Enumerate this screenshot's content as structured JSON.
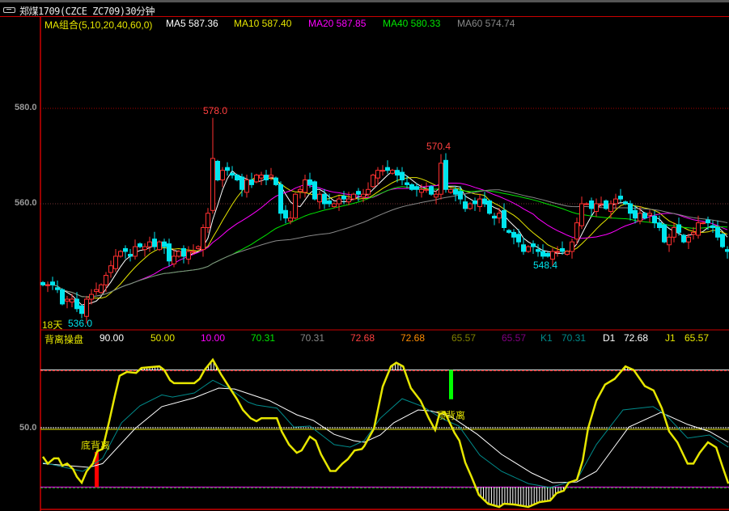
{
  "header": {
    "title": "郑煤1709(CZCE ZC709)30分钟"
  },
  "ma_legend": [
    {
      "label": "MA组合(5,10,20,40,60,0)",
      "color": "#e6e600"
    },
    {
      "label": "MA5 587.36",
      "color": "#ffffff"
    },
    {
      "label": "MA10 587.40",
      "color": "#e6e600"
    },
    {
      "label": "MA20 587.85",
      "color": "#ff00ff"
    },
    {
      "label": "MA40 580.33",
      "color": "#00e600"
    },
    {
      "label": "MA60 574.74",
      "color": "#888888"
    }
  ],
  "indicator_legend": [
    {
      "label": "背离操盘",
      "color": "#e6e600"
    },
    {
      "label": "90.00",
      "color": "#ffffff"
    },
    {
      "label": "50.00",
      "color": "#e6e600"
    },
    {
      "label": "10.00",
      "color": "#ff00ff"
    },
    {
      "label": "70.31",
      "color": "#00e600"
    },
    {
      "label": "70.31",
      "color": "#888888"
    },
    {
      "label": "72.68",
      "color": "#ff4040"
    },
    {
      "label": "72.68",
      "color": "#ff8c00"
    },
    {
      "label": "65.57",
      "color": "#808000"
    },
    {
      "label": "65.57",
      "color": "#800080"
    },
    {
      "label": "K1",
      "color": "#008b8b"
    },
    {
      "label": "70.31",
      "color": "#008b8b"
    },
    {
      "label": "D1",
      "color": "#ffffff"
    },
    {
      "label": "72.68",
      "color": "#ffffff"
    },
    {
      "label": "J1",
      "color": "#e6e600"
    },
    {
      "label": "65.57",
      "color": "#e6e600"
    }
  ],
  "chart_data": [
    {
      "type": "candlestick",
      "title": "郑煤1709 30分钟",
      "ylim": [
        533,
        590
      ],
      "y_ticks": [
        "580.0",
        "560.0"
      ],
      "y_tick_values": [
        580,
        560
      ],
      "closes": [
        543,
        543,
        543,
        542,
        539,
        540,
        540,
        538,
        537,
        540,
        541,
        542,
        543,
        545,
        547,
        549,
        550,
        550,
        549,
        551,
        551,
        551,
        552,
        551,
        552,
        551,
        548,
        549,
        550,
        549,
        550,
        550,
        551,
        555,
        558,
        569.5,
        565,
        567,
        567,
        566,
        565,
        563,
        565,
        564,
        566,
        566,
        565,
        566,
        564,
        558,
        557,
        557,
        562,
        563,
        565,
        564,
        561,
        562,
        560,
        560,
        560,
        561,
        561,
        561,
        562,
        562,
        562,
        563,
        566,
        567,
        567,
        567,
        567,
        566,
        565,
        564,
        563,
        563,
        563,
        563,
        562,
        562,
        568.5,
        563,
        563,
        562,
        561,
        559,
        560,
        560,
        561,
        560,
        558,
        557,
        558,
        555,
        554,
        553,
        552,
        550,
        551,
        551,
        550,
        549,
        549,
        550,
        550,
        550,
        550,
        552,
        556,
        560,
        560,
        559,
        560,
        560,
        559,
        560,
        561,
        561,
        560,
        558,
        557,
        558,
        557,
        558,
        556,
        555,
        552,
        553,
        555,
        554,
        552,
        553,
        554,
        556,
        556,
        556,
        555,
        553,
        551,
        550
      ],
      "annotations": [
        {
          "text": "578.0",
          "price": 578.0,
          "color": "#ff4040"
        },
        {
          "text": "570.4",
          "price": 570.4,
          "color": "#ff4040"
        },
        {
          "text": "548.4",
          "price": 548.4,
          "color": "#00e5ee"
        },
        {
          "text": "18天",
          "color": "#e6e600"
        },
        {
          "text": "536.0",
          "price": 536.0,
          "color": "#00e5ee"
        }
      ],
      "ma_periods": [
        5,
        10,
        20,
        40,
        60
      ]
    },
    {
      "type": "line",
      "title": "背离操盘",
      "ylim": [
        -5,
        100
      ],
      "y_ticks": [
        "50.0"
      ],
      "levels": [
        90,
        50,
        10
      ],
      "series": [
        {
          "name": "J1",
          "color": "#e6e600",
          "points": [
            [
              0,
              30.7
            ],
            [
              1,
              26
            ],
            [
              2.3,
              29.6
            ],
            [
              3.2,
              29.6
            ],
            [
              4,
              24.6
            ],
            [
              5,
              26
            ],
            [
              6.2,
              22.4
            ],
            [
              7,
              17
            ],
            [
              8,
              13
            ],
            [
              9,
              20.7
            ],
            [
              10.3,
              26
            ],
            [
              11.2,
              34.5
            ],
            [
              12.3,
              36
            ],
            [
              13.7,
              55.5
            ],
            [
              14.8,
              72
            ],
            [
              15.8,
              86
            ],
            [
              17.3,
              88.7
            ],
            [
              19.2,
              88
            ],
            [
              20.3,
              91.4
            ],
            [
              24,
              92.5
            ],
            [
              25,
              90
            ],
            [
              26.2,
              83
            ],
            [
              27,
              81
            ],
            [
              31.2,
              81
            ],
            [
              32.3,
              84
            ],
            [
              33.3,
              90
            ],
            [
              35,
              97
            ],
            [
              36.7,
              87
            ],
            [
              38.3,
              78.7
            ],
            [
              40,
              70
            ],
            [
              41.2,
              62.7
            ],
            [
              42.8,
              57
            ],
            [
              44,
              55
            ],
            [
              45,
              57
            ],
            [
              48.2,
              57
            ],
            [
              49.2,
              48
            ],
            [
              50.7,
              39
            ],
            [
              52.3,
              33.4
            ],
            [
              53.3,
              35
            ],
            [
              55,
              44.5
            ],
            [
              56.2,
              41.7
            ],
            [
              57.3,
              32.3
            ],
            [
              59.2,
              21
            ],
            [
              60.3,
              21
            ],
            [
              61.7,
              26
            ],
            [
              62.8,
              29
            ],
            [
              64.2,
              35
            ],
            [
              65.7,
              36
            ],
            [
              66.2,
              38
            ],
            [
              68.2,
              50
            ],
            [
              70,
              78.7
            ],
            [
              71.7,
              92.5
            ],
            [
              72.8,
              95
            ],
            [
              74.2,
              92.5
            ],
            [
              75.8,
              77.6
            ],
            [
              77.8,
              69
            ],
            [
              79.5,
              57
            ],
            [
              80.8,
              49
            ],
            [
              81.7,
              60
            ],
            [
              82.8,
              61
            ],
            [
              84.8,
              47
            ],
            [
              85.8,
              41.7
            ],
            [
              87,
              26.8
            ],
            [
              88.3,
              16.9
            ],
            [
              89.8,
              4.7
            ],
            [
              91.7,
              -1.4
            ],
            [
              94,
              -3.6
            ],
            [
              95,
              -1.4
            ],
            [
              97.3,
              -2
            ],
            [
              100,
              -3.6
            ],
            [
              102.3,
              -0.3
            ],
            [
              104.5,
              0.8
            ],
            [
              105.8,
              5.8
            ],
            [
              107.3,
              7.5
            ],
            [
              108.3,
              13
            ],
            [
              110,
              15
            ],
            [
              111.2,
              28
            ],
            [
              112.3,
              50
            ],
            [
              114,
              69
            ],
            [
              115.8,
              80
            ],
            [
              117.8,
              84
            ],
            [
              120,
              92.5
            ],
            [
              121.7,
              90
            ],
            [
              124,
              79
            ],
            [
              125.8,
              76
            ],
            [
              127.5,
              63.8
            ],
            [
              129,
              48
            ],
            [
              130.7,
              40.6
            ],
            [
              132.8,
              26
            ],
            [
              134,
              26
            ],
            [
              135.3,
              33.4
            ],
            [
              137,
              40.6
            ],
            [
              138.7,
              37
            ],
            [
              140,
              24
            ],
            [
              141.2,
              12.4
            ]
          ]
        },
        {
          "name": "K1",
          "color": "#008b8b",
          "points": [
            [
              0,
              26.8
            ],
            [
              8.2,
              20.7
            ],
            [
              12.3,
              29.6
            ],
            [
              16.2,
              53.9
            ],
            [
              20,
              65.5
            ],
            [
              24.5,
              73
            ],
            [
              26.7,
              71.5
            ],
            [
              31.2,
              74.3
            ],
            [
              35,
              83
            ],
            [
              38.3,
              77.6
            ],
            [
              42.3,
              68
            ],
            [
              44,
              66
            ],
            [
              48.2,
              64
            ],
            [
              51.7,
              51
            ],
            [
              55,
              51.7
            ],
            [
              60,
              39
            ],
            [
              63.3,
              37.3
            ],
            [
              66.2,
              41.7
            ],
            [
              69.5,
              57
            ],
            [
              74,
              70.4
            ],
            [
              78.3,
              65
            ],
            [
              82.3,
              56.6
            ],
            [
              85.7,
              51.7
            ],
            [
              90,
              31.8
            ],
            [
              94.5,
              20.7
            ],
            [
              100,
              12.4
            ],
            [
              104.5,
              9.7
            ],
            [
              110,
              15
            ],
            [
              114,
              39
            ],
            [
              119.5,
              62.7
            ],
            [
              125.7,
              65
            ],
            [
              128.3,
              59.4
            ],
            [
              132.8,
              43.4
            ],
            [
              137.3,
              45.6
            ],
            [
              141.2,
              37.3
            ]
          ]
        },
        {
          "name": "D1",
          "color": "#ffffff",
          "points": [
            [
              0,
              26
            ],
            [
              9.5,
              23.5
            ],
            [
              12.3,
              26
            ],
            [
              19,
              50
            ],
            [
              24.5,
              65
            ],
            [
              31.2,
              71
            ],
            [
              36.2,
              77.6
            ],
            [
              39.5,
              77
            ],
            [
              46.7,
              69
            ],
            [
              52.3,
              59.4
            ],
            [
              55.7,
              55.5
            ],
            [
              60,
              46
            ],
            [
              64,
              41.7
            ],
            [
              66.2,
              40.6
            ],
            [
              69.5,
              45.6
            ],
            [
              72.3,
              54
            ],
            [
              77.3,
              62.7
            ],
            [
              80,
              62
            ],
            [
              84,
              58.3
            ],
            [
              89.5,
              46
            ],
            [
              94.5,
              32.3
            ],
            [
              100.7,
              19.6
            ],
            [
              105,
              13
            ],
            [
              110,
              13.5
            ],
            [
              114,
              20.7
            ],
            [
              120.7,
              51
            ],
            [
              127.3,
              61
            ],
            [
              132.8,
              52.8
            ],
            [
              137.3,
              48
            ],
            [
              141.2,
              40.6
            ]
          ]
        }
      ],
      "signals": [
        {
          "label": "底背离",
          "bar": 11,
          "from": 10,
          "to": 34,
          "color": "#ff0000"
        },
        {
          "label": "顶背离",
          "bar": 84,
          "from": 70,
          "to": 90,
          "color": "#00ff00"
        }
      ]
    }
  ]
}
